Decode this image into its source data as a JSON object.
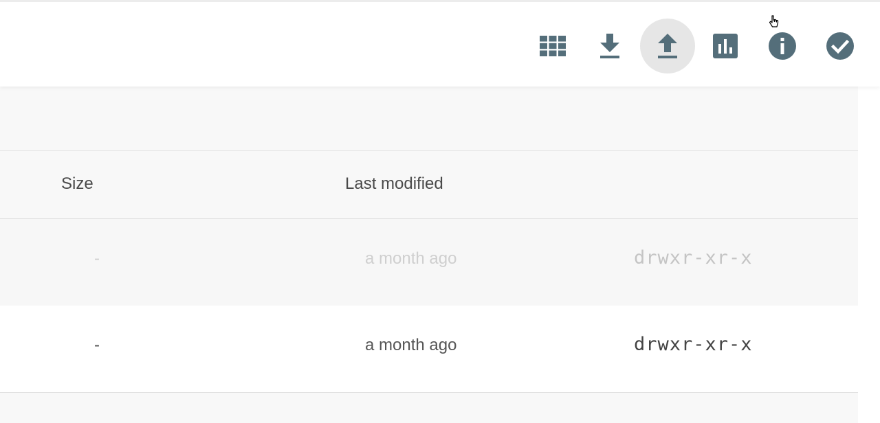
{
  "toolbar": {
    "icons": [
      {
        "name": "grid-view-icon",
        "active": false
      },
      {
        "name": "download-icon",
        "active": false
      },
      {
        "name": "upload-icon",
        "active": true
      },
      {
        "name": "bar-chart-icon",
        "active": false
      },
      {
        "name": "info-icon",
        "active": false
      },
      {
        "name": "check-circle-icon",
        "active": false
      }
    ],
    "icon_color": "#546e7a",
    "active_bg": "#e6e6e6"
  },
  "table": {
    "columns": {
      "size": "Size",
      "last_modified": "Last modified"
    },
    "rows": [
      {
        "size": "-",
        "last_modified": "a month ago",
        "permissions": "drwxr-xr-x",
        "faded": true
      },
      {
        "size": "-",
        "last_modified": "a month ago",
        "permissions": "drwxr-xr-x",
        "faded": false
      }
    ]
  }
}
